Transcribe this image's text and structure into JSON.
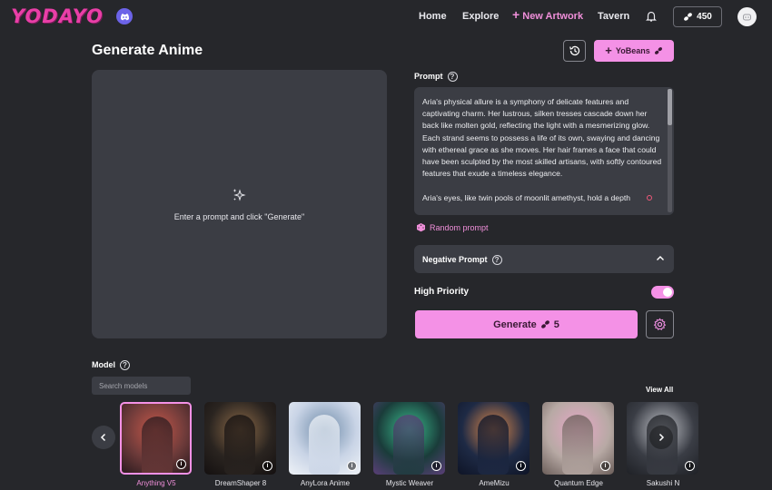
{
  "nav": {
    "logo": "YODAYO",
    "links": [
      "Home",
      "Explore",
      "New Artwork",
      "Tavern"
    ],
    "beans_count": "450"
  },
  "header": {
    "title": "Generate Anime",
    "yobeans_label": "YoBeans"
  },
  "canvas": {
    "hint": "Enter a prompt and click \"Generate\""
  },
  "prompt": {
    "label": "Prompt",
    "text": "Aria's physical allure is a symphony of delicate features and captivating charm. Her lustrous, silken tresses cascade down her back like molten gold, reflecting the light with a mesmerizing glow. Each strand seems to possess a life of its own, swaying and dancing with ethereal grace as she moves. Her hair frames a face that could have been sculpted by the most skilled artisans, with softly contoured features that exude a timeless elegance.\n\nAria's eyes, like twin pools of moonlit amethyst, hold a depth",
    "random_label": "Random prompt"
  },
  "negative_prompt": {
    "label": "Negative Prompt"
  },
  "high_priority": {
    "label": "High Priority",
    "enabled": true
  },
  "generate": {
    "label": "Generate",
    "cost": "5"
  },
  "model": {
    "label": "Model",
    "search_placeholder": "Search models",
    "view_all": "View All",
    "cards": [
      {
        "name": "Anything V5",
        "selected": true,
        "colors": [
          "#6e3b3a",
          "#c7584a",
          "#2b1b1f"
        ]
      },
      {
        "name": "DreamShaper 8",
        "selected": false,
        "colors": [
          "#2a2420",
          "#8c6a48",
          "#141010"
        ]
      },
      {
        "name": "AnyLora Anime",
        "selected": false,
        "colors": [
          "#c9d4e6",
          "#6d8aa8",
          "#eef2f7"
        ]
      },
      {
        "name": "Mystic Weaver",
        "selected": false,
        "colors": [
          "#1a3c3a",
          "#3bbf8f",
          "#5a3f78"
        ]
      },
      {
        "name": "AmeMizu",
        "selected": false,
        "colors": [
          "#1e2a45",
          "#e08a4a",
          "#0e1426"
        ]
      },
      {
        "name": "Quantum Edge",
        "selected": false,
        "colors": [
          "#b7a9a4",
          "#e8a8c8",
          "#6b5e5a"
        ]
      },
      {
        "name": "Sakushi N",
        "selected": false,
        "colors": [
          "#3a3d45",
          "#c4c6cc",
          "#1f2126"
        ]
      }
    ]
  },
  "colors": {
    "accent": "#f491e6",
    "background": "#26272b",
    "panel": "#3b3d44"
  }
}
